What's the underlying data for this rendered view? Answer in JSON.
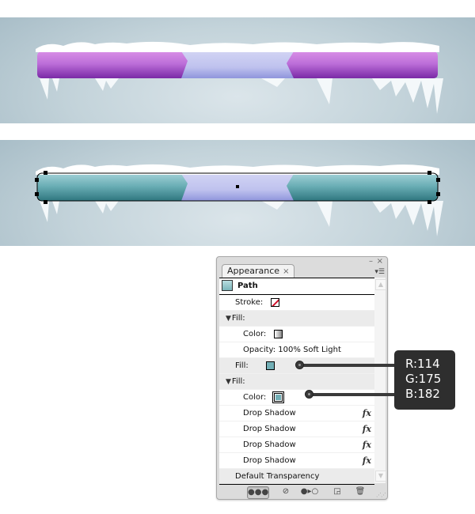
{
  "scenes": [
    {
      "name": "purple-bar",
      "fill_color": "#a24fc9",
      "center_color": "#c4c8ef",
      "selected": false
    },
    {
      "name": "teal-bar",
      "fill_color": "#5fa6ae",
      "center_color": "#c4c8ef",
      "selected": true
    }
  ],
  "panel": {
    "tab_label": "Appearance",
    "tab_close": "×",
    "minimize": "–",
    "close": "×",
    "menu_icon": "▾☰",
    "path_label": "Path",
    "rows": [
      {
        "label": "Stroke:",
        "swatch": "none-stroke"
      },
      {
        "label": "Fill:",
        "expanded": true
      },
      {
        "label": "Color:",
        "swatch": "white-gray-gradient"
      },
      {
        "label": "Opacity: 100% Soft Light"
      },
      {
        "label": "Fill:",
        "swatch": "teal",
        "color": "#72afb6"
      },
      {
        "label": "Fill:",
        "expanded": true
      },
      {
        "label": "Color:",
        "swatch": "teal",
        "color": "#72afb6"
      },
      {
        "label": "Drop Shadow",
        "fx": "fx"
      },
      {
        "label": "Drop Shadow",
        "fx": "fx"
      },
      {
        "label": "Drop Shadow",
        "fx": "fx"
      },
      {
        "label": "Drop Shadow",
        "fx": "fx"
      },
      {
        "label": "Default Transparency"
      }
    ],
    "footer_icons": [
      "new-art-maintains-appearance-icon",
      "clear-appearance-icon",
      "reduce-to-basic-appearance-icon",
      "duplicate-item-icon",
      "delete-item-icon"
    ]
  },
  "callout": {
    "r": "R:114",
    "g": "G:175",
    "b": "B:182",
    "color": "#72afb6"
  }
}
